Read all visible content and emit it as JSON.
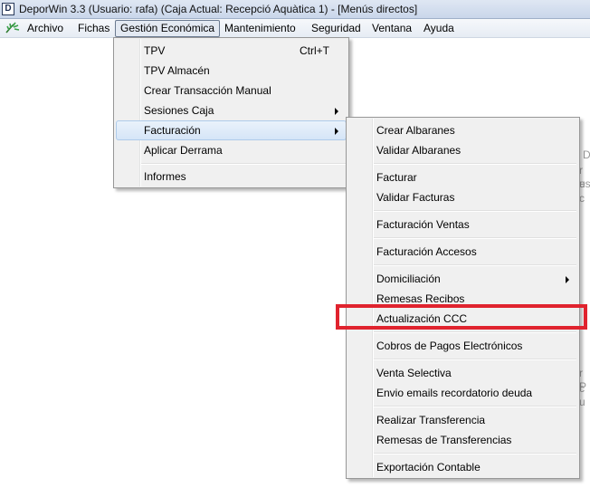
{
  "window": {
    "app_icon_letter": "D",
    "title": "DeporWin 3.3  (Usuario: rafa)  (Caja Actual: Recepció Aquàtica 1) - [Menús directos]"
  },
  "menubar": {
    "icon": "palm-leaf-icon",
    "items": [
      "Archivo",
      "Fichas",
      "Gestión Económica",
      "Mantenimiento",
      "Seguridad",
      "Ventana",
      "Ayuda"
    ]
  },
  "gestion_menu": {
    "items": [
      {
        "label": "TPV",
        "shortcut": "Ctrl+T"
      },
      {
        "label": "TPV Almacén"
      },
      {
        "label": "Crear Transacción Manual"
      },
      {
        "label": "Sesiones Caja",
        "submenu": true
      },
      {
        "label": "Facturación",
        "submenu": true,
        "highlighted": true
      },
      {
        "label": "Aplicar Derrama"
      },
      {
        "label": "Informes"
      }
    ]
  },
  "facturacion_menu": {
    "items": [
      {
        "label": "Crear Albaranes"
      },
      {
        "label": "Validar Albaranes"
      },
      {
        "label": "Facturar"
      },
      {
        "label": "Validar Facturas"
      },
      {
        "label": "Facturación Ventas"
      },
      {
        "label": "Facturación Accesos"
      },
      {
        "label": "Domiciliación",
        "submenu": true
      },
      {
        "label": "Remesas Recibos"
      },
      {
        "label": "Actualización CCC",
        "annotated": true
      },
      {
        "label": "Cobros de Pagos Electrónicos"
      },
      {
        "label": "Venta Selectiva"
      },
      {
        "label": "Envio emails recordatorio deuda"
      },
      {
        "label": "Realizar Transferencia"
      },
      {
        "label": "Remesas de Transferencias"
      },
      {
        "label": "Exportación Contable"
      }
    ]
  },
  "annotation": {
    "color": "#e0232e"
  },
  "background_fragments": [
    "D",
    "r u",
    "es",
    "c",
    "r P",
    "c u"
  ]
}
